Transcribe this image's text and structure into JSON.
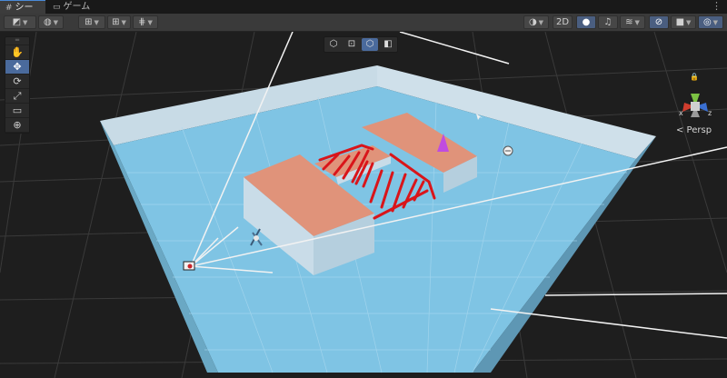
{
  "tabs": [
    {
      "label": "シーン",
      "icon": "grid-icon",
      "active": true
    },
    {
      "label": "ゲーム",
      "icon": "gamepad-icon",
      "active": false
    }
  ],
  "tab_menu": "⋮",
  "toolbar": {
    "draw_mode_icon": "shaded-icon",
    "gizmo_globe_icon": "globe-icon",
    "move_snap_icon": "move-snap-icon",
    "grid_snap_icon": "grid-snap-icon",
    "increment_snap_icon": "increment-snap-icon",
    "render_mode_icon": "sphere-icon",
    "toggle_2d_label": "2D",
    "light_icon": "lightbulb-icon",
    "audio_icon": "audio-icon",
    "fx_icon": "fx-icon",
    "visibility_icon": "eye-slash-icon",
    "camera_icon": "camera-icon",
    "gizmos_icon": "gizmos-icon"
  },
  "tools": [
    {
      "name": "hand-tool",
      "glyph": "✋",
      "selected": false
    },
    {
      "name": "move-tool",
      "glyph": "✥",
      "selected": true
    },
    {
      "name": "rotate-tool",
      "glyph": "⟳",
      "selected": false
    },
    {
      "name": "scale-tool",
      "glyph": "⤢",
      "selected": false
    },
    {
      "name": "rect-tool",
      "glyph": "▭",
      "selected": false
    },
    {
      "name": "transform-tool",
      "glyph": "⊕",
      "selected": false
    }
  ],
  "overlay_buttons": [
    {
      "name": "cube-view",
      "glyph": "⬡",
      "selected": false
    },
    {
      "name": "rect-view",
      "glyph": "⊡",
      "selected": false
    },
    {
      "name": "wire-view",
      "glyph": "⬡",
      "selected": true
    },
    {
      "name": "color-view",
      "glyph": "◧",
      "selected": false
    }
  ],
  "view_label": "< Persp",
  "colors": {
    "floor": "#7fc4e4",
    "wall": "#c8dbe6",
    "platform": "#e0937a",
    "stroke": "#d9151a",
    "cone": "#c04ce0",
    "accent": "#4a8ad8"
  }
}
